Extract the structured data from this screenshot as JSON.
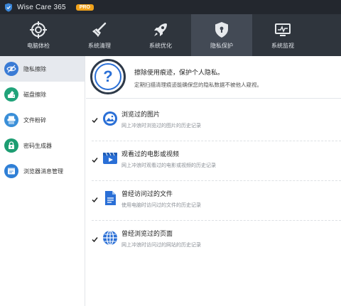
{
  "app": {
    "title": "Wise Care 365",
    "badge": "PRO"
  },
  "topnav": [
    {
      "label": "电脑体检",
      "icon": "target-icon"
    },
    {
      "label": "系统清理",
      "icon": "broom-icon"
    },
    {
      "label": "系统优化",
      "icon": "rocket-icon"
    },
    {
      "label": "隐私保护",
      "icon": "shield-lock-icon",
      "active": true
    },
    {
      "label": "系统监视",
      "icon": "monitor-icon"
    }
  ],
  "sidebar": {
    "items": [
      {
        "label": "隐私擦除",
        "icon": "eye-icon",
        "color": "#3a7bd5",
        "active": true
      },
      {
        "label": "磁盘擦除",
        "icon": "disk-eraser-icon",
        "color": "#21a37a"
      },
      {
        "label": "文件粉碎",
        "icon": "shredder-icon",
        "color": "#3a8fd8"
      },
      {
        "label": "密码生成器",
        "icon": "lock-icon",
        "color": "#1d9d72"
      },
      {
        "label": "浏览器消息管理",
        "icon": "browser-icon",
        "color": "#2f7fd6"
      }
    ]
  },
  "header": {
    "title": "擦除使用痕迹，保护个人隐私。",
    "subtitle": "定期扫描清理痕迹能确保您的隐私数据不被他人窥视。"
  },
  "items": [
    {
      "title": "浏览过的图片",
      "desc": "网上冲浪时浏览过的图片的历史记录",
      "icon": "picture-icon",
      "checked": true
    },
    {
      "title": "观看过的电影或视频",
      "desc": "网上冲浪时观看过的电影或视频的历史记录",
      "icon": "video-icon",
      "checked": true
    },
    {
      "title": "曾经访问过的文件",
      "desc": "使用电脑时访问过的文件的历史记录",
      "icon": "document-icon",
      "checked": true
    },
    {
      "title": "曾经浏览过的页面",
      "desc": "网上冲浪时访问过的网站的历史记录",
      "icon": "globe-icon",
      "checked": true
    }
  ],
  "colors": {
    "accent": "#2a6fd6",
    "nav_bg": "#2f353d",
    "title_bg": "#23272e",
    "badge": "#f0a21c"
  }
}
